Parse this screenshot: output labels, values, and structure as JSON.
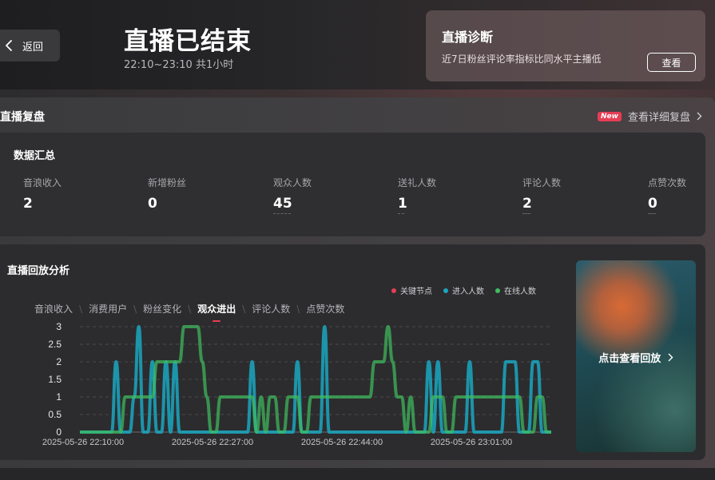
{
  "header": {
    "back_label": "返回",
    "title": "直播已结束",
    "time": "22:10~23:10 共1小时"
  },
  "diagnosis": {
    "title": "直播诊断",
    "desc": "近7日粉丝评论率指标比同水平主播低",
    "button": "查看"
  },
  "review": {
    "title": "直播复盘",
    "badge": "New",
    "detail_link": "查看详细复盘"
  },
  "summary": {
    "title": "数据汇总",
    "metrics": [
      {
        "label": "音浪收入",
        "value": "2"
      },
      {
        "label": "新增粉丝",
        "value": "0"
      },
      {
        "label": "观众人数",
        "value": "45"
      },
      {
        "label": "送礼人数",
        "value": "1"
      },
      {
        "label": "评论人数",
        "value": "2"
      },
      {
        "label": "点赞次数",
        "value": "0"
      }
    ]
  },
  "analysis": {
    "title": "直播回放分析",
    "tabs": [
      "音浪收入",
      "消费用户",
      "粉丝变化",
      "观众进出",
      "评论人数",
      "点赞次数"
    ],
    "active_tab": "观众进出",
    "legend": [
      {
        "name": "关键节点",
        "color": "#e63e55"
      },
      {
        "name": "进入人数",
        "color": "#1aa7c0"
      },
      {
        "name": "在线人数",
        "color": "#3fbf5f"
      }
    ]
  },
  "replay": {
    "label": "点击查看回放"
  },
  "chart_data": {
    "type": "line",
    "x_ticks": [
      "2025-05-26 22:10:00",
      "2025-05-26 22:27:00",
      "2025-05-26 22:44:00",
      "2025-05-26 23:01:00"
    ],
    "y_ticks": [
      "0",
      "0.5",
      "1",
      "1.5",
      "2",
      "2.5",
      "3"
    ],
    "ylim": [
      0,
      3
    ],
    "grid": true,
    "legend_position": "top-right",
    "series": [
      {
        "name": "进入人数",
        "color": "#1aa7c0",
        "values": [
          0,
          0,
          0,
          0,
          0,
          0,
          0,
          0,
          2,
          0,
          0,
          0,
          1,
          3,
          0,
          0,
          2,
          0,
          0,
          2,
          0,
          2,
          0,
          0,
          0,
          0,
          0,
          0,
          0,
          0,
          0,
          0,
          0,
          0,
          0,
          0,
          0,
          0,
          2,
          0,
          0,
          0,
          0,
          0,
          0,
          0,
          0,
          0,
          2,
          0,
          0,
          0,
          0,
          0,
          3,
          0,
          0,
          0,
          0,
          0,
          0,
          0,
          0,
          0,
          0,
          0,
          0,
          0,
          0,
          0,
          0,
          0,
          0,
          0,
          0,
          0,
          0,
          2,
          0,
          2,
          0,
          0,
          0,
          0,
          0,
          0,
          2,
          0,
          0,
          0,
          0,
          0,
          0,
          0,
          2,
          2,
          2,
          0,
          0,
          0,
          2,
          2,
          0,
          0,
          0
        ]
      },
      {
        "name": "在线人数",
        "color": "#3fbf5f",
        "values": [
          0,
          0,
          0,
          0,
          0,
          0,
          0,
          0,
          0,
          0,
          1,
          1,
          1,
          1,
          1,
          1,
          1,
          2,
          2,
          2,
          2,
          2,
          2,
          3,
          3,
          3,
          3,
          2,
          1,
          0,
          0,
          1,
          1,
          1,
          1,
          1,
          1,
          1,
          1,
          0,
          1,
          0,
          1,
          1,
          0,
          0,
          1,
          1,
          1,
          0,
          0,
          1,
          1,
          1,
          1,
          1,
          1,
          1,
          1,
          1,
          1,
          1,
          1,
          1,
          1,
          2,
          2,
          2,
          3,
          2,
          1,
          1,
          0,
          1,
          0,
          0,
          0,
          0,
          1,
          1,
          1,
          0,
          0,
          1,
          1,
          1,
          1,
          1,
          1,
          1,
          1,
          1,
          1,
          1,
          1,
          1,
          1,
          1,
          0,
          0,
          0,
          1,
          1,
          0,
          0
        ]
      }
    ]
  }
}
